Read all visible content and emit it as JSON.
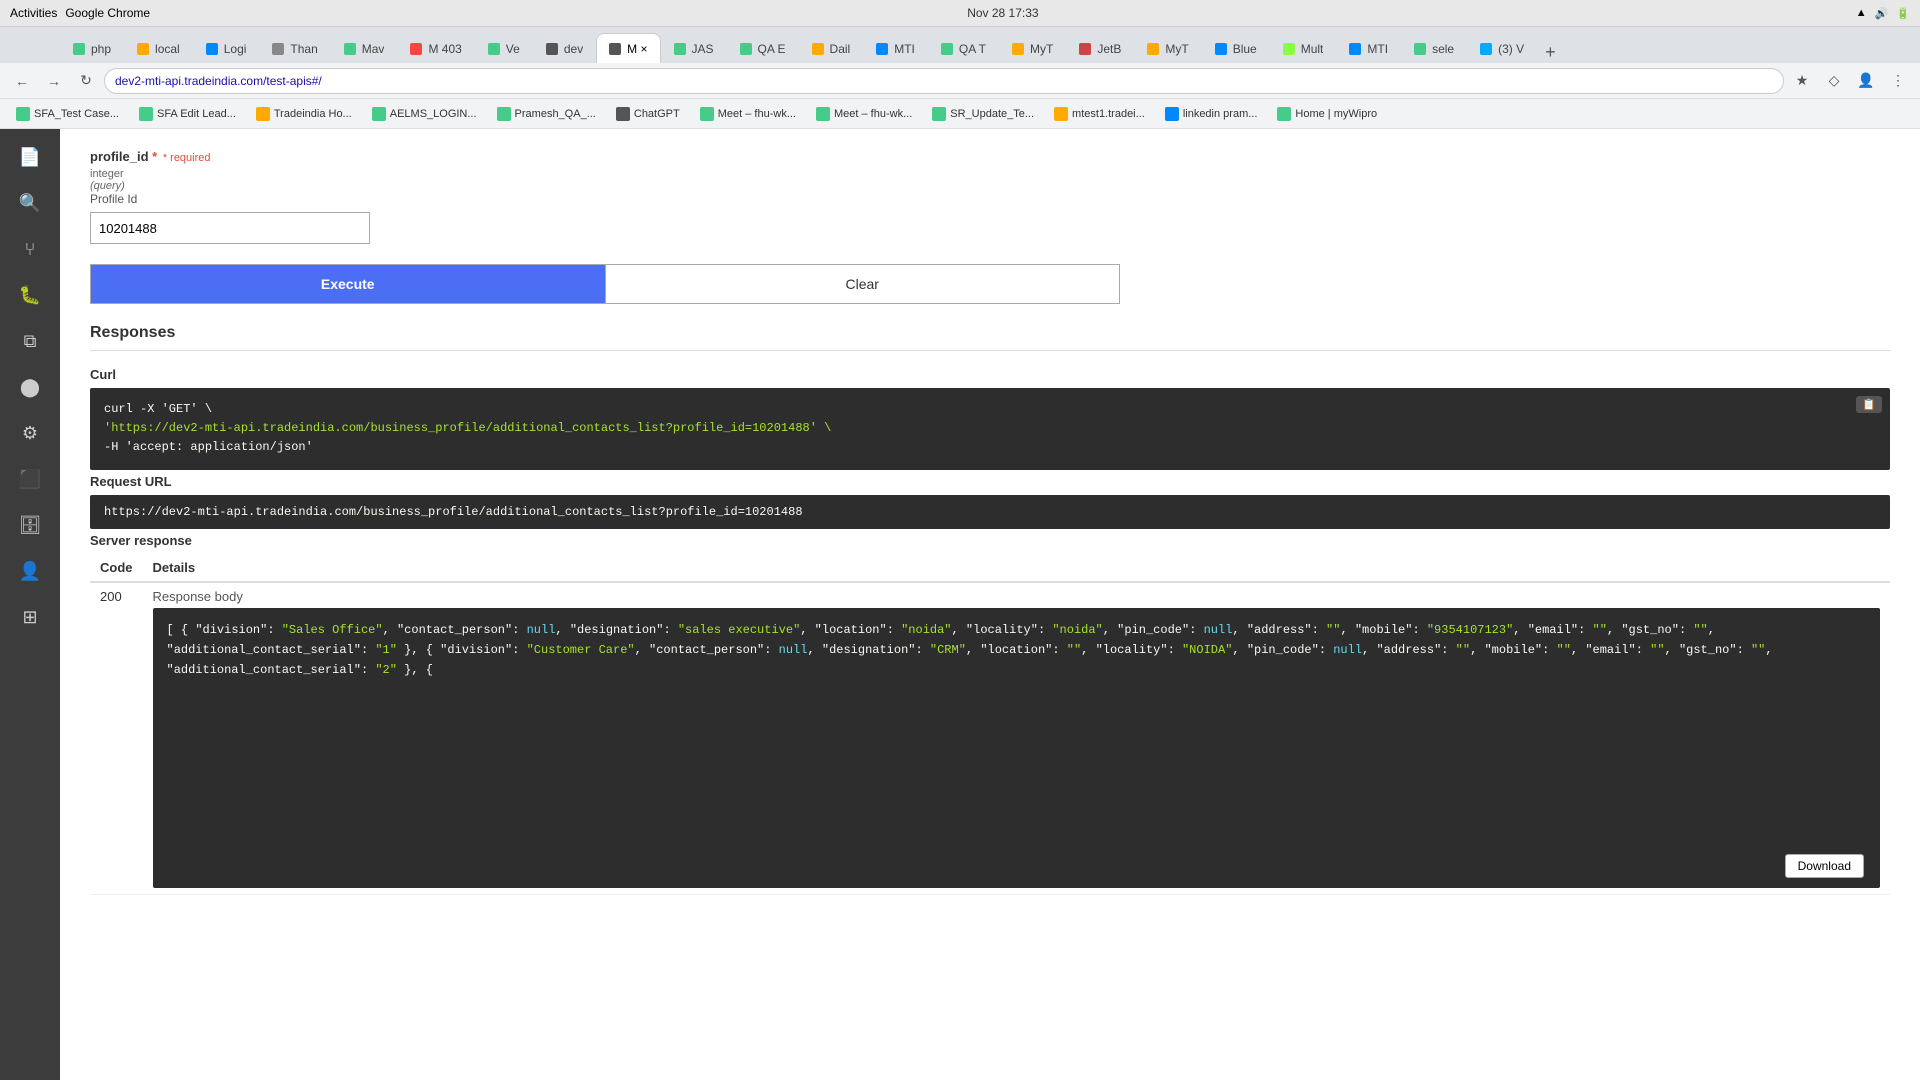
{
  "os": {
    "activities": "Activities",
    "app_name": "Google Chrome",
    "datetime": "Nov 28  17:33"
  },
  "tabs": [
    {
      "id": "tab1",
      "label": "php",
      "active": false,
      "favicon_color": "#4c8"
    },
    {
      "id": "tab2",
      "label": "local",
      "active": false,
      "favicon_color": "#fa0"
    },
    {
      "id": "tab3",
      "label": "Logi",
      "active": false,
      "favicon_color": "#08f"
    },
    {
      "id": "tab4",
      "label": "Than",
      "active": false,
      "favicon_color": "#888"
    },
    {
      "id": "tab5",
      "label": "Mav",
      "active": false,
      "favicon_color": "#4c8"
    },
    {
      "id": "tab6",
      "label": "M 403",
      "active": false,
      "favicon_color": "#f44"
    },
    {
      "id": "tab7",
      "label": "Ve",
      "active": false,
      "favicon_color": "#4c8"
    },
    {
      "id": "tab8",
      "label": "dev",
      "active": false,
      "favicon_color": "#555"
    },
    {
      "id": "tab9",
      "label": "M ×",
      "active": true,
      "favicon_color": "#555"
    },
    {
      "id": "tab10",
      "label": "JAS",
      "active": false,
      "favicon_color": "#4c8"
    },
    {
      "id": "tab11",
      "label": "QA E",
      "active": false,
      "favicon_color": "#4c8"
    },
    {
      "id": "tab12",
      "label": "Dail",
      "active": false,
      "favicon_color": "#fa0"
    },
    {
      "id": "tab13",
      "label": "MTI",
      "active": false,
      "favicon_color": "#08f"
    },
    {
      "id": "tab14",
      "label": "QA T",
      "active": false,
      "favicon_color": "#4c8"
    },
    {
      "id": "tab15",
      "label": "MyT",
      "active": false,
      "favicon_color": "#fa0"
    },
    {
      "id": "tab16",
      "label": "JetB",
      "active": false,
      "favicon_color": "#c44"
    },
    {
      "id": "tab17",
      "label": "MyT",
      "active": false,
      "favicon_color": "#fa0"
    },
    {
      "id": "tab18",
      "label": "Blue",
      "active": false,
      "favicon_color": "#08f"
    },
    {
      "id": "tab19",
      "label": "Mult",
      "active": false,
      "favicon_color": "#8f4"
    },
    {
      "id": "tab20",
      "label": "MTI",
      "active": false,
      "favicon_color": "#08f"
    },
    {
      "id": "tab21",
      "label": "sele",
      "active": false,
      "favicon_color": "#4c8"
    },
    {
      "id": "tab22",
      "label": "(3) V",
      "active": false,
      "favicon_color": "#0af"
    }
  ],
  "address_bar": {
    "url": "dev2-mti-api.tradeindia.com/test-apis#/"
  },
  "bookmarks": [
    {
      "label": "SFA_Test Case...",
      "color": "#4c8"
    },
    {
      "label": "SFA Edit Lead...",
      "color": "#4c8"
    },
    {
      "label": "Tradeindia Ho...",
      "color": "#fa0"
    },
    {
      "label": "AELMS_LOGIN...",
      "color": "#4c8"
    },
    {
      "label": "Pramesh_QA_...",
      "color": "#4c8"
    },
    {
      "label": "ChatGPT",
      "color": "#555"
    },
    {
      "label": "Meet – fhu-wk...",
      "color": "#4c8"
    },
    {
      "label": "Meet – fhu-wk...",
      "color": "#4c8"
    },
    {
      "label": "SR_Update_Te...",
      "color": "#4c8"
    },
    {
      "label": "mtest1.tradei...",
      "color": "#fa0"
    },
    {
      "label": "linkedin pram...",
      "color": "#08f"
    },
    {
      "label": "Home | myWipro",
      "color": "#4c8"
    }
  ],
  "sidebar_icons": [
    {
      "name": "files-icon",
      "symbol": "📄"
    },
    {
      "name": "search-icon",
      "symbol": "🔍"
    },
    {
      "name": "source-control-icon",
      "symbol": "⑂"
    },
    {
      "name": "debug-icon",
      "symbol": "🐛"
    },
    {
      "name": "extensions-icon",
      "symbol": "⧉"
    },
    {
      "name": "chrome-icon",
      "symbol": "⬤"
    },
    {
      "name": "settings-icon",
      "symbol": "⚙"
    },
    {
      "name": "terminal-icon",
      "symbol": "⬛"
    },
    {
      "name": "database-icon",
      "symbol": "🗄"
    },
    {
      "name": "user-icon",
      "symbol": "👤"
    },
    {
      "name": "apps-icon",
      "symbol": "⊞"
    }
  ],
  "swagger": {
    "param": {
      "name": "profile_id",
      "required_label": "* required",
      "type": "integer",
      "query_label": "(query)",
      "description": "Profile Id",
      "value": "10201488"
    },
    "buttons": {
      "execute_label": "Execute",
      "clear_label": "Clear"
    },
    "responses_title": "Responses",
    "curl_section": {
      "label": "Curl",
      "line1": "curl -X 'GET' \\",
      "line2": "  'https://dev2-mti-api.tradeindia.com/business_profile/additional_contacts_list?profile_id=10201488' \\",
      "line3": "  -H 'accept: application/json'"
    },
    "request_url_section": {
      "label": "Request URL",
      "url": "https://dev2-mti-api.tradeindia.com/business_profile/additional_contacts_list?profile_id=10201488"
    },
    "server_response": {
      "label": "Server response",
      "code_header": "Code",
      "details_header": "Details",
      "code": "200",
      "response_body_label": "Response body"
    },
    "response_body": {
      "download_label": "Download",
      "json_text": "[\n  {\n    \"division\": \"Sales Office\",\n    \"contact_person\": null,\n    \"designation\": \"sales executive\",\n    \"location\": \"noida\",\n    \"locality\": \"noida\",\n    \"pin_code\": null,\n    \"address\": \"\",\n    \"mobile\": \"9354107123\",\n    \"email\": \"\",\n    \"gst_no\": \"\",\n    \"additional_contact_serial\": \"1\"\n  },\n  {\n    \"division\": \"Customer Care\",\n    \"contact_person\": null,\n    \"designation\": \"CRM\",\n    \"location\": \"\",\n    \"locality\": \"NOIDA\",\n    \"pin_code\": null,\n    \"address\": \"\",\n    \"mobile\": \"\",\n    \"email\": \"\",\n    \"gst_no\": \"\",\n    \"additional_contact_serial\": \"2\"\n  },\n  {"
    }
  }
}
